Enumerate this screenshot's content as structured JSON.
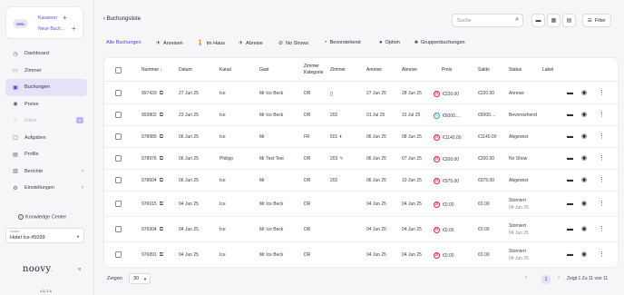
{
  "sidebar": {
    "avatar_text": "GRD",
    "user_role": "Kassierer",
    "new_booking": "Neue Buch...",
    "items": [
      {
        "label": "Dashboard",
        "icon": "dashboard-icon"
      },
      {
        "label": "Zimmer",
        "icon": "room-icon"
      },
      {
        "label": "Buchungen",
        "icon": "booking-icon",
        "active": true
      },
      {
        "label": "Preise",
        "icon": "price-icon"
      },
      {
        "label": "Inbox",
        "icon": "inbox-icon",
        "badge": "0",
        "disabled": true
      },
      {
        "label": "Aufgaben",
        "icon": "tasks-icon"
      },
      {
        "label": "Profile",
        "icon": "profile-icon"
      },
      {
        "label": "Berichte",
        "icon": "reports-icon"
      },
      {
        "label": "Einstellungen",
        "icon": "settings-icon"
      }
    ],
    "knowledge_center": "Knowledge Center",
    "hotel_label": "Hotels",
    "hotel_value": "Hotel Ice #5039",
    "logo": "noovy",
    "version": "v11.1.6"
  },
  "header": {
    "back": "‹ Buchungsliste",
    "search_placeholder": "Suche",
    "filter": "Filter"
  },
  "tabs": [
    "Alle Buchungen",
    "Anreisen",
    "Im Haus",
    "Abreise",
    "No Shows",
    "Bevorstehend",
    "Option",
    "Gruppenbuchungen"
  ],
  "table": {
    "columns": [
      "Nummer ↓",
      "Datum",
      "Kanal",
      "Gast",
      "Zimmer Kategorie",
      "Zimmer",
      "Anreise",
      "Abreise",
      "Preis",
      "Saldo",
      "Status",
      "Label"
    ],
    "rows": [
      {
        "nummer": "997429",
        "datum": "27 Jun 25",
        "kanal": "Ice",
        "gast": "Mr Ice Beck",
        "kat": "DR",
        "zimmer": "",
        "anreise": "27 Jun 25",
        "abreise": "28 Jun 25",
        "preis": "€220.00",
        "saldo": "€220.00",
        "status": "Anreise",
        "status2": ""
      },
      {
        "nummer": "993802",
        "datum": "23 Jun 25",
        "kanal": "Ice",
        "gast": "Mr Ice Beck",
        "kat": "DR",
        "zimmer": "202",
        "anreise": "01 Jul 25",
        "abreise": "31 Jul 25",
        "preis": "€6000....",
        "saldo": "€6000....",
        "status": "Bevorstehend",
        "status2": ""
      },
      {
        "nummer": "978989",
        "datum": "06 Jun 25",
        "kanal": "Ice",
        "gast": "Mr",
        "kat": "FR",
        "zimmer": "501",
        "anreise": "06 Jun 25",
        "abreise": "08 Jun 25",
        "preis": "€1140.00",
        "saldo": "€1140.00",
        "status": "Abgereist",
        "status2": ""
      },
      {
        "nummer": "978976",
        "datum": "06 Jun 25",
        "kanal": "Philipp",
        "gast": "Mr Test Test",
        "kat": "DR",
        "zimmer": "203",
        "anreise": "06 Jun 25",
        "abreise": "07 Jun 25",
        "preis": "€200.00",
        "saldo": "€200.00",
        "status": "No Show",
        "status2": ""
      },
      {
        "nummer": "978604",
        "datum": "06 Jun 25",
        "kanal": "Ice",
        "gast": "Mr",
        "kat": "DR",
        "zimmer": "202",
        "anreise": "06 Jun 25",
        "abreise": "10 Jun 25",
        "preis": "€975.00",
        "saldo": "€975.00",
        "status": "Abgereist",
        "status2": ""
      },
      {
        "nummer": "976915",
        "datum": "04 Jun 25",
        "kanal": "Ice",
        "gast": "Mr Ice Beck",
        "kat": "DR",
        "zimmer": "",
        "anreise": "04 Jun 25",
        "abreise": "04 Jun 25",
        "preis": "€0.00",
        "saldo": "€0.00",
        "status": "Storniert",
        "status2": "04 Jun 25"
      },
      {
        "nummer": "976904",
        "datum": "04 Jun 25",
        "kanal": "Ice",
        "gast": "Mr Ice Beck",
        "kat": "DR",
        "zimmer": "",
        "anreise": "04 Jun 25",
        "abreise": "04 Jun 25",
        "preis": "€0.00",
        "saldo": "€0.00",
        "status": "Storniert",
        "status2": "04 Jun 25"
      },
      {
        "nummer": "976891",
        "datum": "04 Jun 25",
        "kanal": "Ice",
        "gast": "Mr Ice Beck",
        "kat": "DR",
        "zimmer": "",
        "anreise": "04 Jun 25",
        "abreise": "04 Jun 25",
        "preis": "€0.00",
        "saldo": "€0.00",
        "status": "Storniert",
        "status2": "04 Jun 25"
      }
    ]
  },
  "footer": {
    "show_label": "Zeigen",
    "page_size": "30",
    "current_page": "1",
    "summary": "Zeigt 1 Zu 11 von 11"
  },
  "colors": {
    "accent": "#4a3fcf",
    "payment_red": "#d22a46",
    "payment_teal": "#2aa5b8",
    "active_bg": "#e4e2f6"
  }
}
